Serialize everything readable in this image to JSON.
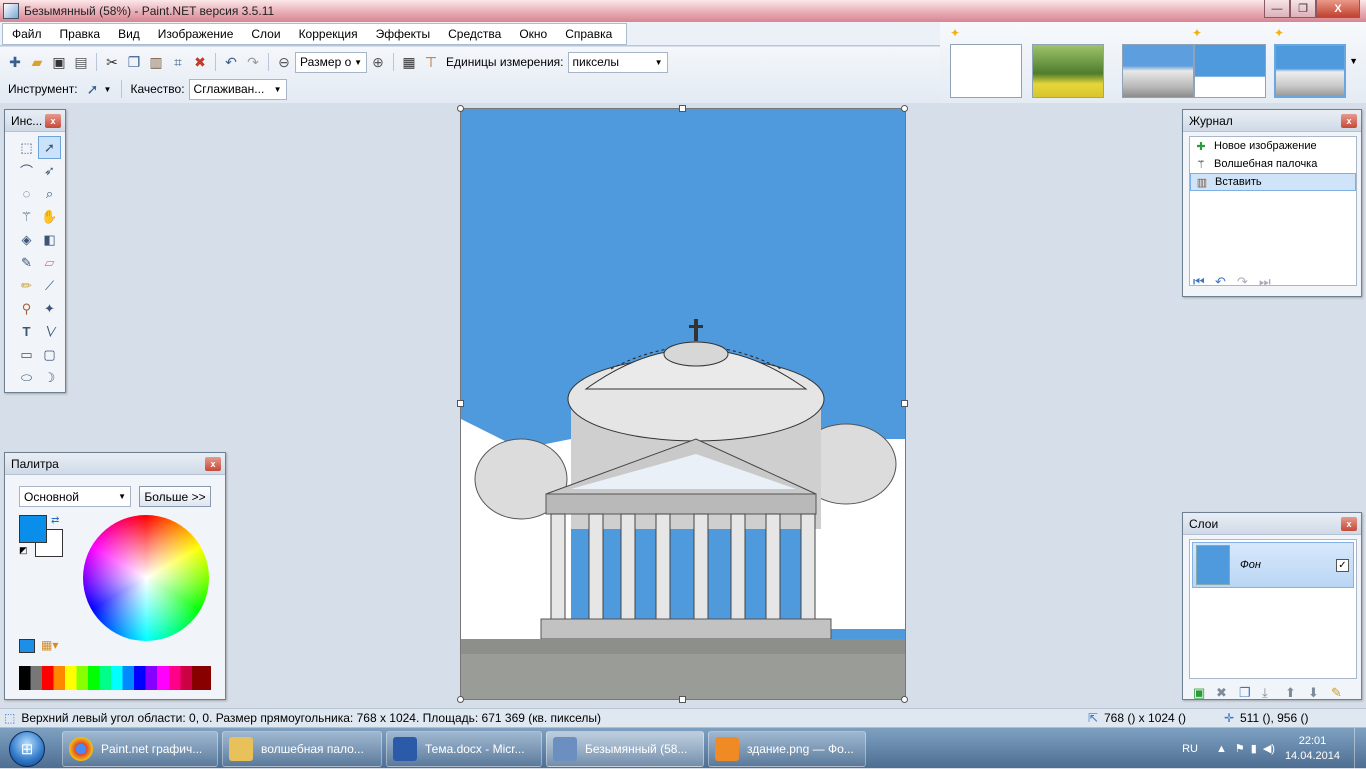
{
  "window": {
    "title": "Безымянный (58%) - Paint.NET версия 3.5.11",
    "btn_min": "—",
    "btn_max": "❐",
    "btn_close": "X"
  },
  "menu": [
    "Файл",
    "Правка",
    "Вид",
    "Изображение",
    "Слои",
    "Коррекция",
    "Эффекты",
    "Средства",
    "Окно",
    "Справка"
  ],
  "toolbar": {
    "zoom_combo": "Размер о",
    "units_label": "Единицы измерения:",
    "units_value": "пикселы",
    "tool_label": "Инструмент:",
    "quality_label": "Качество:",
    "quality_value": "Сглаживан..."
  },
  "tools_panel": {
    "title": "Инс...",
    "close": "x"
  },
  "history_panel": {
    "title": "Журнал",
    "close": "x",
    "items": [
      {
        "label": "Новое изображение",
        "icon": "new-image-icon"
      },
      {
        "label": "Волшебная палочка",
        "icon": "magic-wand-icon"
      },
      {
        "label": "Вставить",
        "icon": "paste-icon"
      }
    ]
  },
  "palette_panel": {
    "title": "Палитра",
    "close": "x",
    "mode": "Основной",
    "more_button": "Больше >>",
    "primary_color": "#0a8eea",
    "secondary_color": "#ffffff"
  },
  "layers_panel": {
    "title": "Слои",
    "close": "x",
    "layer_name": "Фон",
    "layer_visible": "✓"
  },
  "status": {
    "selection_info": "Верхний левый угол области: 0, 0. Размер прямоугольника: 768 x 1024. Площадь: 671 369 (кв. пикселы)",
    "image_size": "768 () x 1024 ()",
    "cursor_pos": "511 (), 956 ()"
  },
  "taskbar": {
    "items": [
      {
        "label": "Paint.net графич...",
        "icon_color": "#e0452f"
      },
      {
        "label": "волшебная пало...",
        "icon_color": "#e8c15a"
      },
      {
        "label": "Тема.docx - Micr...",
        "icon_color": "#2b5aa8"
      },
      {
        "label": "Безымянный (58...",
        "icon_color": "#6a8fc0"
      },
      {
        "label": "здание.png — Фо...",
        "icon_color": "#f08a24"
      }
    ],
    "lang": "RU",
    "time": "22:01",
    "date": "14.04.2014"
  }
}
